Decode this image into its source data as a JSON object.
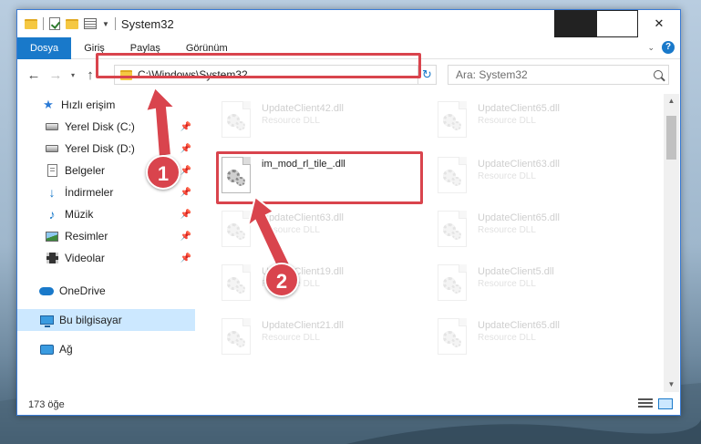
{
  "window": {
    "title": "System32",
    "controls": {
      "minimize": "minimize",
      "maximize": "maximize",
      "close": "✕"
    }
  },
  "ribbon": {
    "tabs": [
      "Dosya",
      "Giriş",
      "Paylaş",
      "Görünüm"
    ],
    "help": "?"
  },
  "navbar": {
    "back": "←",
    "forward": "→",
    "recent": "▾",
    "up": "↑",
    "address": "C:\\Windows\\System32",
    "refresh": "↻",
    "search_placeholder": "Ara: System32"
  },
  "sidebar": {
    "quick_access": "Hızlı erişim",
    "items": [
      {
        "label": "Yerel Disk (C:)",
        "icon": "drive-icon",
        "pinned": true
      },
      {
        "label": "Yerel Disk (D:)",
        "icon": "drive-icon",
        "pinned": true
      },
      {
        "label": "Belgeler",
        "icon": "documents-icon",
        "pinned": true
      },
      {
        "label": "İndirmeler",
        "icon": "download-icon",
        "pinned": true
      },
      {
        "label": "Müzik",
        "icon": "music-icon",
        "pinned": true
      },
      {
        "label": "Resimler",
        "icon": "pictures-icon",
        "pinned": true
      },
      {
        "label": "Videolar",
        "icon": "videos-icon",
        "pinned": true
      }
    ],
    "onedrive": "OneDrive",
    "this_pc": "Bu bilgisayar",
    "network": "Ağ"
  },
  "files": {
    "left_column": [
      {
        "name": "UpdateClient42.dll",
        "desc": "Resource DLL",
        "faded": true
      },
      {
        "name": "im_mod_rl_tile_.dll",
        "desc": "",
        "faded": false
      },
      {
        "name": "UpdateClient63.dll",
        "desc": "Resource DLL",
        "faded": true
      },
      {
        "name": "UpdateClient19.dll",
        "desc": "Resource DLL",
        "faded": true
      },
      {
        "name": "UpdateClient21.dll",
        "desc": "Resource DLL",
        "faded": true
      }
    ],
    "right_column": [
      {
        "name": "UpdateClient65.dll",
        "desc": "Resource DLL",
        "faded": true
      },
      {
        "name": "UpdateClient63.dll",
        "desc": "Resource DLL",
        "faded": true
      },
      {
        "name": "UpdateClient65.dll",
        "desc": "Resource DLL",
        "faded": true
      },
      {
        "name": "UpdateClient5.dll",
        "desc": "Resource DLL",
        "faded": true
      },
      {
        "name": "UpdateClient65.dll",
        "desc": "Resource DLL",
        "faded": true
      }
    ]
  },
  "status": {
    "count": "173 öğe"
  },
  "callouts": [
    "1",
    "2"
  ],
  "colors": {
    "accent": "#1979ca",
    "highlight": "#d9444d",
    "selected": "#cce8ff"
  }
}
